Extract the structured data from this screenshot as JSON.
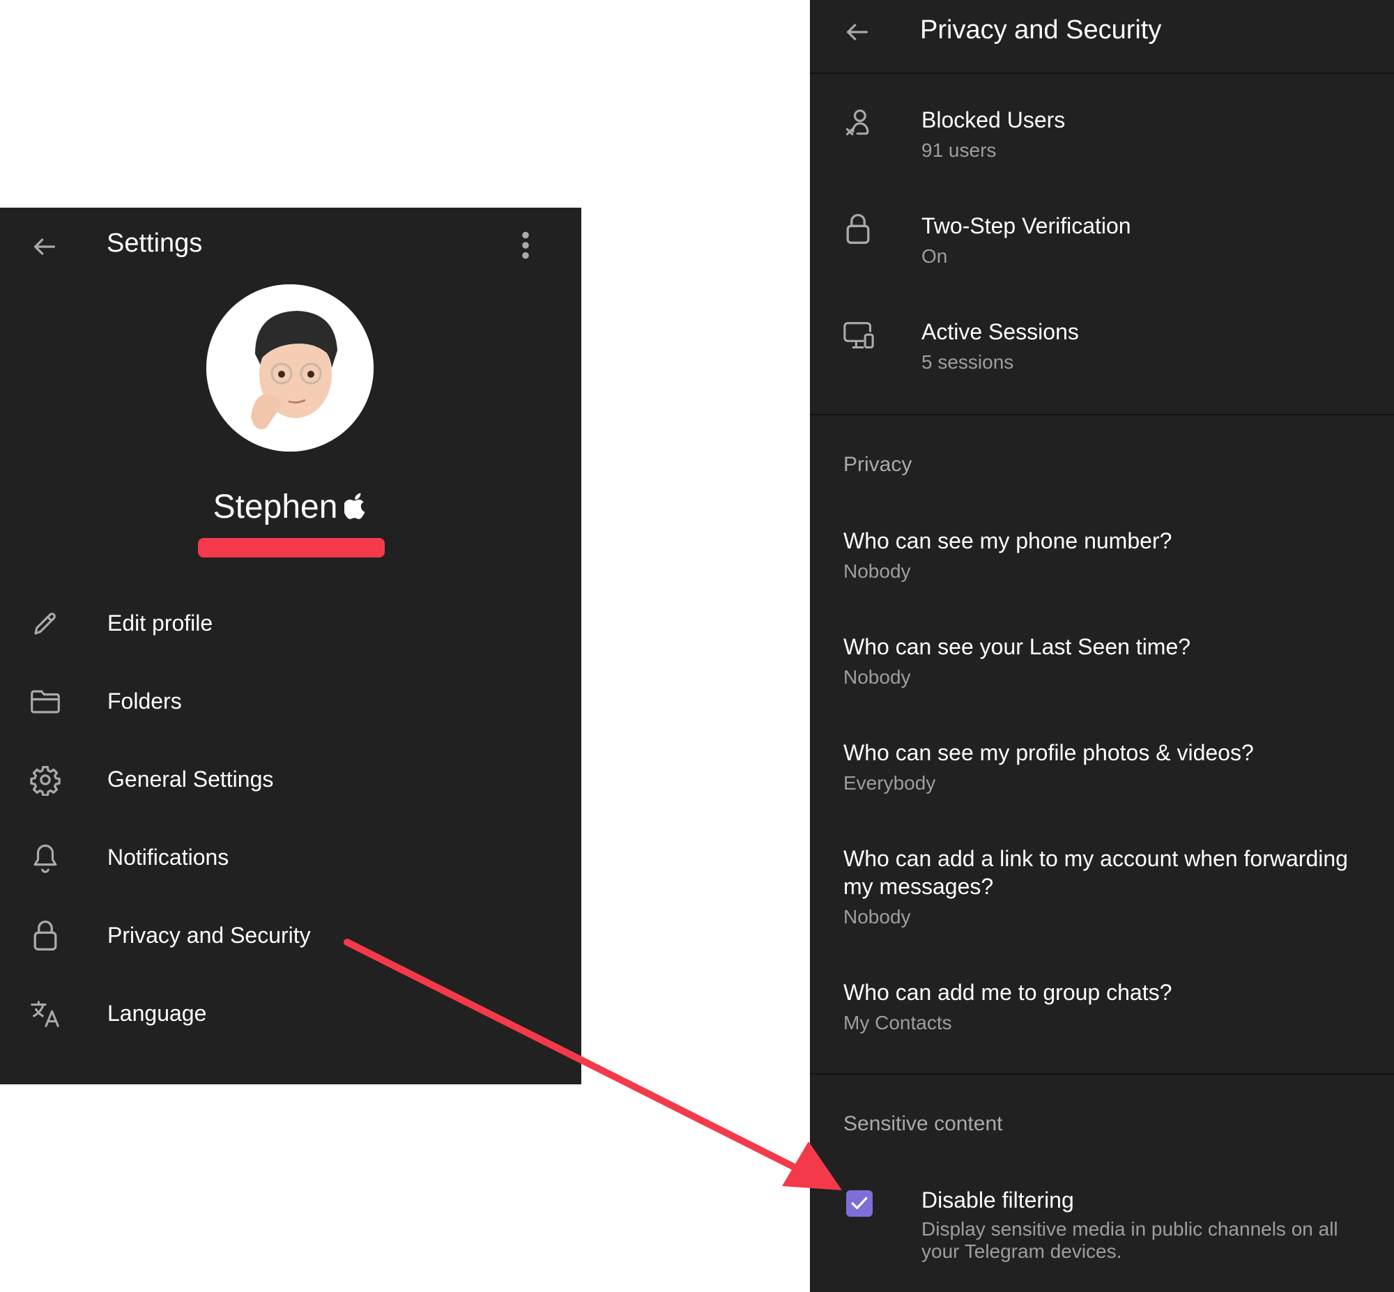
{
  "settings": {
    "title": "Settings",
    "profile_name": "Stephen",
    "menu": [
      {
        "label": "Edit profile",
        "icon": "pencil-icon"
      },
      {
        "label": "Folders",
        "icon": "folder-icon"
      },
      {
        "label": "General Settings",
        "icon": "gear-icon"
      },
      {
        "label": "Notifications",
        "icon": "bell-icon"
      },
      {
        "label": "Privacy and Security",
        "icon": "lock-icon"
      },
      {
        "label": "Language",
        "icon": "translate-icon"
      }
    ]
  },
  "privacy": {
    "title": "Privacy and Security",
    "security_items": [
      {
        "label": "Blocked Users",
        "value": "91 users",
        "icon": "blocked-user-icon"
      },
      {
        "label": "Two-Step Verification",
        "value": "On",
        "icon": "lock-icon"
      },
      {
        "label": "Active Sessions",
        "value": "5 sessions",
        "icon": "devices-icon"
      }
    ],
    "privacy_header": "Privacy",
    "privacy_items": [
      {
        "label": "Who can see my phone number?",
        "value": "Nobody"
      },
      {
        "label": "Who can see your Last Seen time?",
        "value": "Nobody"
      },
      {
        "label": "Who can see my profile photos & videos?",
        "value": "Everybody"
      },
      {
        "label_line1": "Who can add a link to my account when forwarding",
        "label_line2": "my messages?",
        "value": "Nobody"
      },
      {
        "label": "Who can add me to group chats?",
        "value": "My Contacts"
      }
    ],
    "sensitive_header": "Sensitive content",
    "sensitive": {
      "label": "Disable filtering",
      "desc_line1": "Display sensitive media in public channels on all",
      "desc_line2": "your Telegram devices.",
      "checked": true
    }
  },
  "colors": {
    "panel_bg": "#212121",
    "text": "#ffffff",
    "secondary_text": "#9e9e9e",
    "accent_checkbox": "#7e6fd8",
    "annotation_red": "#f43a4a"
  }
}
